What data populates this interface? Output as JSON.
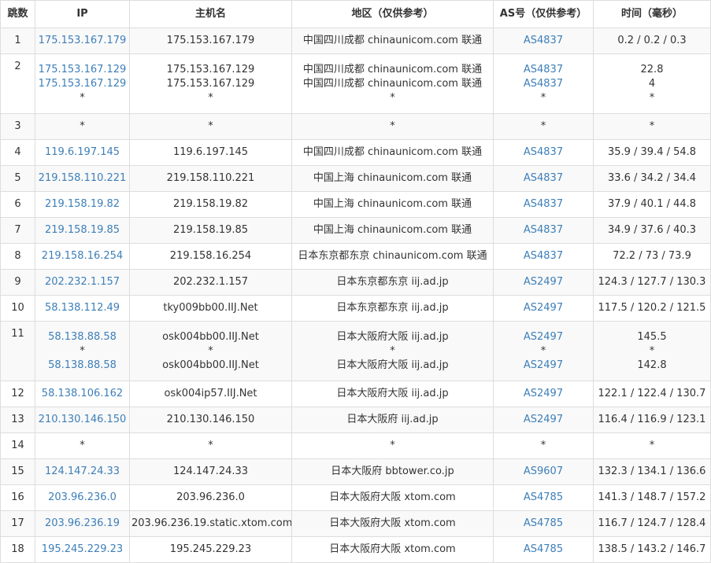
{
  "headers": {
    "hop": "跳数",
    "ip": "IP",
    "host": "主机名",
    "region": "地区（仅供参考）",
    "as": "AS号（仅供参考）",
    "time": "时间（毫秒）"
  },
  "rows": [
    {
      "hop": "1",
      "ip": [
        "175.153.167.179"
      ],
      "host": [
        "175.153.167.179"
      ],
      "region": [
        "中国四川成都 chinaunicom.com 联通"
      ],
      "as": [
        "AS4837"
      ],
      "time": [
        "0.2 / 0.2 / 0.3"
      ]
    },
    {
      "hop": "2",
      "ip": [
        "175.153.167.129",
        "175.153.167.129",
        "*"
      ],
      "host": [
        "175.153.167.129",
        "175.153.167.129",
        "*"
      ],
      "region": [
        "中国四川成都 chinaunicom.com 联通",
        "中国四川成都 chinaunicom.com 联通",
        "*"
      ],
      "as": [
        "AS4837",
        "AS4837",
        "*"
      ],
      "time": [
        "22.8",
        "4",
        "*"
      ]
    },
    {
      "hop": "3",
      "ip": [
        "*"
      ],
      "host": [
        "*"
      ],
      "region": [
        "*"
      ],
      "as": [
        "*"
      ],
      "time": [
        "*"
      ]
    },
    {
      "hop": "4",
      "ip": [
        "119.6.197.145"
      ],
      "host": [
        "119.6.197.145"
      ],
      "region": [
        "中国四川成都 chinaunicom.com 联通"
      ],
      "as": [
        "AS4837"
      ],
      "time": [
        "35.9 / 39.4 / 54.8"
      ]
    },
    {
      "hop": "5",
      "ip": [
        "219.158.110.221"
      ],
      "host": [
        "219.158.110.221"
      ],
      "region": [
        "中国上海 chinaunicom.com 联通"
      ],
      "as": [
        "AS4837"
      ],
      "time": [
        "33.6 / 34.2 / 34.4"
      ]
    },
    {
      "hop": "6",
      "ip": [
        "219.158.19.82"
      ],
      "host": [
        "219.158.19.82"
      ],
      "region": [
        "中国上海 chinaunicom.com 联通"
      ],
      "as": [
        "AS4837"
      ],
      "time": [
        "37.9 / 40.1 / 44.8"
      ]
    },
    {
      "hop": "7",
      "ip": [
        "219.158.19.85"
      ],
      "host": [
        "219.158.19.85"
      ],
      "region": [
        "中国上海 chinaunicom.com 联通"
      ],
      "as": [
        "AS4837"
      ],
      "time": [
        "34.9 / 37.6 / 40.3"
      ]
    },
    {
      "hop": "8",
      "ip": [
        "219.158.16.254"
      ],
      "host": [
        "219.158.16.254"
      ],
      "region": [
        "日本东京都东京 chinaunicom.com 联通"
      ],
      "as": [
        "AS4837"
      ],
      "time": [
        "72.2 / 73 / 73.9"
      ]
    },
    {
      "hop": "9",
      "ip": [
        "202.232.1.157"
      ],
      "host": [
        "202.232.1.157"
      ],
      "region": [
        "日本东京都东京 iij.ad.jp"
      ],
      "as": [
        "AS2497"
      ],
      "time": [
        "124.3 / 127.7 / 130.3"
      ]
    },
    {
      "hop": "10",
      "ip": [
        "58.138.112.49"
      ],
      "host": [
        "tky009bb00.IIJ.Net"
      ],
      "region": [
        "日本东京都东京 iij.ad.jp"
      ],
      "as": [
        "AS2497"
      ],
      "time": [
        "117.5 / 120.2 / 121.5"
      ]
    },
    {
      "hop": "11",
      "ip": [
        "58.138.88.58",
        "*",
        "58.138.88.58"
      ],
      "host": [
        "osk004bb00.IIJ.Net",
        "*",
        "osk004bb00.IIJ.Net"
      ],
      "region": [
        "日本大阪府大阪 iij.ad.jp",
        "*",
        "日本大阪府大阪 iij.ad.jp"
      ],
      "as": [
        "AS2497",
        "*",
        "AS2497"
      ],
      "time": [
        "145.5",
        "*",
        "142.8"
      ]
    },
    {
      "hop": "12",
      "ip": [
        "58.138.106.162"
      ],
      "host": [
        "osk004ip57.IIJ.Net"
      ],
      "region": [
        "日本大阪府大阪 iij.ad.jp"
      ],
      "as": [
        "AS2497"
      ],
      "time": [
        "122.1 / 122.4 / 130.7"
      ]
    },
    {
      "hop": "13",
      "ip": [
        "210.130.146.150"
      ],
      "host": [
        "210.130.146.150"
      ],
      "region": [
        "日本大阪府 iij.ad.jp"
      ],
      "as": [
        "AS2497"
      ],
      "time": [
        "116.4 / 116.9 / 123.1"
      ]
    },
    {
      "hop": "14",
      "ip": [
        "*"
      ],
      "host": [
        "*"
      ],
      "region": [
        "*"
      ],
      "as": [
        "*"
      ],
      "time": [
        "*"
      ]
    },
    {
      "hop": "15",
      "ip": [
        "124.147.24.33"
      ],
      "host": [
        "124.147.24.33"
      ],
      "region": [
        "日本大阪府 bbtower.co.jp"
      ],
      "as": [
        "AS9607"
      ],
      "time": [
        "132.3 / 134.1 / 136.6"
      ]
    },
    {
      "hop": "16",
      "ip": [
        "203.96.236.0"
      ],
      "host": [
        "203.96.236.0"
      ],
      "region": [
        "日本大阪府大阪 xtom.com"
      ],
      "as": [
        "AS4785"
      ],
      "time": [
        "141.3 / 148.7 / 157.2"
      ]
    },
    {
      "hop": "17",
      "ip": [
        "203.96.236.19"
      ],
      "host": [
        "203.96.236.19.static.xtom.com"
      ],
      "region": [
        "日本大阪府大阪 xtom.com"
      ],
      "as": [
        "AS4785"
      ],
      "time": [
        "116.7 / 124.7 / 128.4"
      ]
    },
    {
      "hop": "18",
      "ip": [
        "195.245.229.23"
      ],
      "host": [
        "195.245.229.23"
      ],
      "region": [
        "日本大阪府大阪 xtom.com"
      ],
      "as": [
        "AS4785"
      ],
      "time": [
        "138.5 / 143.2 / 146.7"
      ]
    }
  ]
}
